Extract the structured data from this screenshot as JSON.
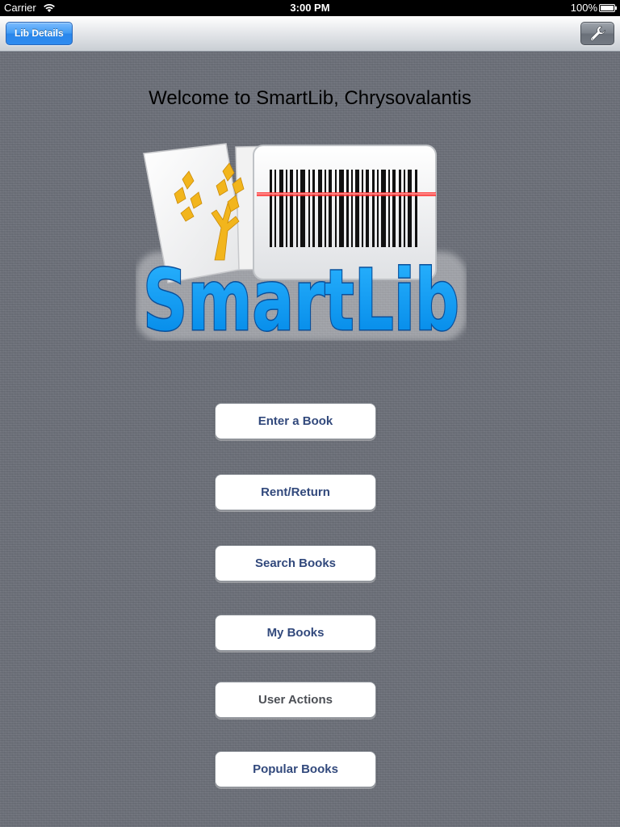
{
  "status_bar": {
    "carrier": "Carrier",
    "time": "3:00 PM",
    "battery": "100%"
  },
  "nav_bar": {
    "left_button_label": "Lib Details",
    "right_button_icon": "wrench-icon"
  },
  "welcome": "Welcome to SmartLib, Chrysovalantis",
  "logo": {
    "text": "SmartLib",
    "brand_color": "#0096f0"
  },
  "menu": {
    "enter_book": "Enter a Book",
    "rent_return": "Rent/Return",
    "search_books": "Search Books",
    "my_books": "My Books",
    "user_actions": "User Actions",
    "popular_books": "Popular Books"
  }
}
